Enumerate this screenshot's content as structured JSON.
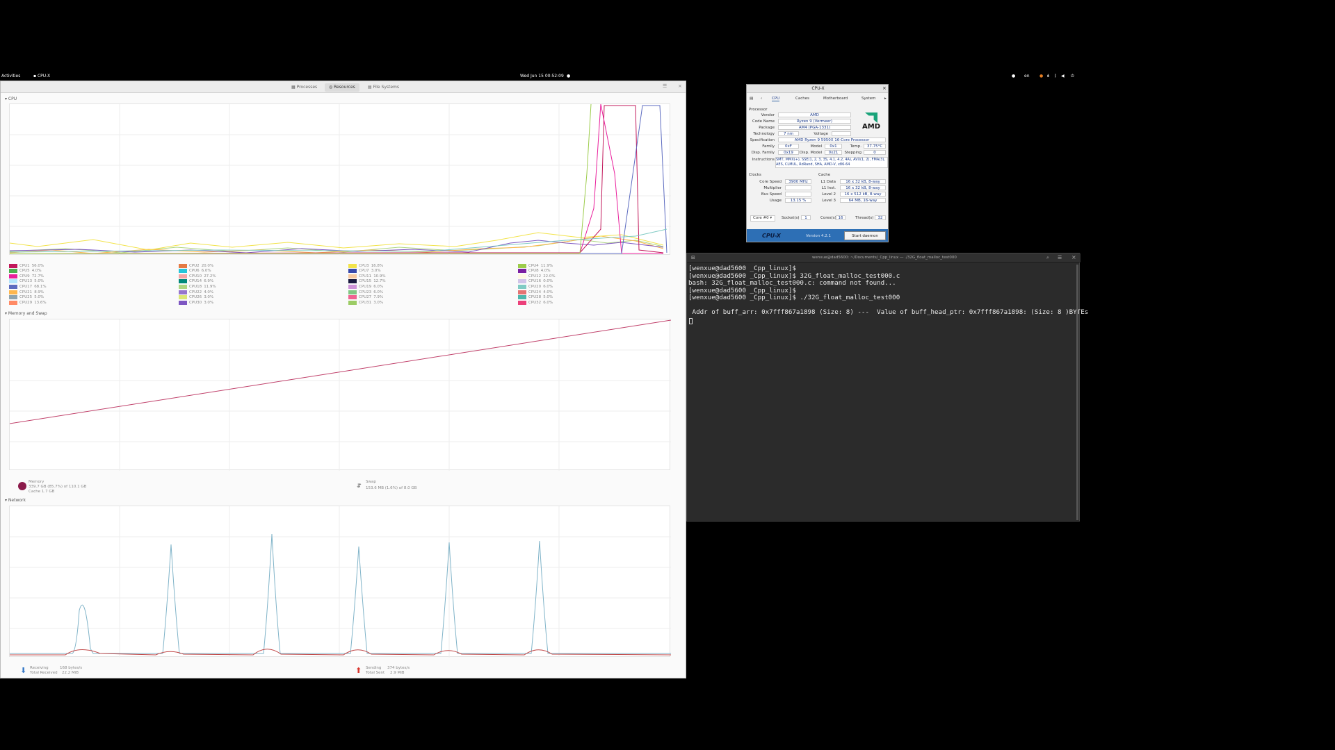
{
  "topbar": {
    "activities": "Activities",
    "app_name": "CPU-X",
    "datetime": "Wed Jun 15  00:52:09",
    "lang": "en"
  },
  "system_monitor": {
    "tabs": [
      "Processes",
      "Resources",
      "File Systems"
    ],
    "active_tab": "Resources",
    "cpu_section": "CPU",
    "cpu_legend": [
      {
        "label": "CPU1",
        "value": "56.0%",
        "color": "#c2185b"
      },
      {
        "label": "CPU2",
        "value": "20.0%",
        "color": "#e57a44"
      },
      {
        "label": "CPU3",
        "value": "16.8%",
        "color": "#f2e34a"
      },
      {
        "label": "CPU4",
        "value": "11.9%",
        "color": "#9ccc4a"
      },
      {
        "label": "CPU5",
        "value": "4.0%",
        "color": "#4caf50"
      },
      {
        "label": "CPU6",
        "value": "6.0%",
        "color": "#26c6da"
      },
      {
        "label": "CPU7",
        "value": "3.0%",
        "color": "#3949ab"
      },
      {
        "label": "CPU8",
        "value": "4.0%",
        "color": "#7b1fa2"
      },
      {
        "label": "CPU9",
        "value": "72.7%",
        "color": "#e91e9b"
      },
      {
        "label": "CPU10",
        "value": "27.2%",
        "color": "#f4a6a6"
      },
      {
        "label": "CPU11",
        "value": "10.9%",
        "color": "#f7c9a0"
      },
      {
        "label": "CPU12",
        "value": "22.0%",
        "color": "#fff8e1"
      },
      {
        "label": "CPU13",
        "value": "5.0%",
        "color": "#b3e5fc"
      },
      {
        "label": "CPU14",
        "value": "6.9%",
        "color": "#00897b"
      },
      {
        "label": "CPU15",
        "value": "12.7%",
        "color": "#1a1a40"
      },
      {
        "label": "CPU16",
        "value": "0.0%",
        "color": "#d1c4e9"
      },
      {
        "label": "CPU17",
        "value": "68.1%",
        "color": "#5c6bc0"
      },
      {
        "label": "CPU18",
        "value": "11.9%",
        "color": "#aed581"
      },
      {
        "label": "CPU19",
        "value": "6.0%",
        "color": "#ce93d8"
      },
      {
        "label": "CPU20",
        "value": "6.0%",
        "color": "#80cbc4"
      },
      {
        "label": "CPU21",
        "value": "8.9%",
        "color": "#ffb74d"
      },
      {
        "label": "CPU22",
        "value": "4.0%",
        "color": "#9575cd"
      },
      {
        "label": "CPU23",
        "value": "6.0%",
        "color": "#81c784"
      },
      {
        "label": "CPU24",
        "value": "4.0%",
        "color": "#e57373"
      },
      {
        "label": "CPU25",
        "value": "5.0%",
        "color": "#90a4ae"
      },
      {
        "label": "CPU26",
        "value": "3.0%",
        "color": "#dce775"
      },
      {
        "label": "CPU27",
        "value": "7.9%",
        "color": "#f06292"
      },
      {
        "label": "CPU28",
        "value": "5.0%",
        "color": "#4db6ac"
      },
      {
        "label": "CPU29",
        "value": "13.6%",
        "color": "#ff8a65"
      },
      {
        "label": "CPU30",
        "value": "3.0%",
        "color": "#7e57c2"
      },
      {
        "label": "CPU31",
        "value": "3.0%",
        "color": "#9ccc65"
      },
      {
        "label": "CPU32",
        "value": "6.0%",
        "color": "#ec407a"
      }
    ],
    "memory_section": "Memory and Swap",
    "memory": {
      "label": "Memory",
      "detail": "339.7 GB (85.7%) of 110.1 GB",
      "cache": "Cache 1.7 GB"
    },
    "swap": {
      "label": "Swap",
      "detail": "153.6 MB (1.6%) of 8.0 GB"
    },
    "network_section": "Network",
    "receiving": {
      "label": "Receiving",
      "rate": "168 bytes/s",
      "total_label": "Total Received",
      "total": "22.2 MiB"
    },
    "sending": {
      "label": "Sending",
      "rate": "374 bytes/s",
      "total_label": "Total Sent",
      "total": "2.9 MiB"
    }
  },
  "cpux": {
    "title": "CPU-X",
    "tabs": [
      "CPU",
      "Caches",
      "Motherboard",
      "System"
    ],
    "processor_group": "Processor",
    "vendor_label": "Vendor",
    "vendor": "AMD",
    "codename_label": "Code Name",
    "codename": "Ryzen 9 (Vermeer)",
    "package_label": "Package",
    "package": "AM4 (PGA-1331)",
    "technology_label": "Technology",
    "technology": "7 nm",
    "voltage_label": "Voltage",
    "voltage": "",
    "spec_label": "Specification",
    "spec": "AMD Ryzen 9 5950X 16-Core Processor",
    "family_label": "Family",
    "family": "0xF",
    "model_label": "Model",
    "model": "0x1",
    "temp_label": "Temp.",
    "temp": "37.75°C",
    "dispfamily_label": "Disp. Family",
    "dispfamily": "0x19",
    "dispmodel_label": "Disp. Model",
    "dispmodel": "0x21",
    "stepping_label": "Stepping",
    "stepping": "0",
    "instructions_label": "Instructions",
    "instructions_1": "SMT, MMX(+), SSE(1, 2, 3, 3S, 4.1, 4.2, 4A), AVX(1, 2), FMA(3),",
    "instructions_2": "AES, CLMUL, RdRand, SHA, AMD-V, x86-64",
    "clocks_group": "Clocks",
    "corespeed_label": "Core Speed",
    "corespeed": "3900 MHz",
    "multiplier_label": "Multiplier",
    "multiplier": "",
    "busspeed_label": "Bus Speed",
    "busspeed": "",
    "usage_label": "Usage",
    "usage": "13.15 %",
    "cache_group": "Cache",
    "l1data_label": "L1 Data",
    "l1data": "16 x 32 kB, 8-way",
    "l1inst_label": "L1 Inst.",
    "l1inst": "16 x 32 kB, 8-way",
    "l2_label": "Level 2",
    "l2": "16 x 512 kB, 8-way",
    "l3_label": "Level 3",
    "l3": "64 MB, 16-way",
    "core_select": "Core #0",
    "sockets_label": "Socket(s)",
    "sockets": "1",
    "cores_label": "Cores(s)",
    "cores": "16",
    "threads_label": "Thread(s)",
    "threads": "32",
    "logo": "AMD",
    "footer_brand": "CPU-X",
    "version": "Version 4.2.1",
    "start_daemon": "Start daemon"
  },
  "terminal": {
    "title": "wenxue@dad5600: ~/Documents/_Cpp_linux — ./32G_float_malloc_test000",
    "lines": [
      "[wenxue@dad5600 _Cpp_linux]$",
      "[wenxue@dad5600 _Cpp_linux]$ 32G_float_malloc_test000.c",
      "bash: 32G_float_malloc_test000.c: command not found...",
      "[wenxue@dad5600 _Cpp_linux]$",
      "[wenxue@dad5600 _Cpp_linux]$ ./32G_float_malloc_test000",
      "",
      " Addr of buff_arr: 0x7fff867a1898 (Size: 8) ---  Value of buff_head_ptr: 0x7fff867a1898: (Size: 8 )BYTEs"
    ]
  }
}
